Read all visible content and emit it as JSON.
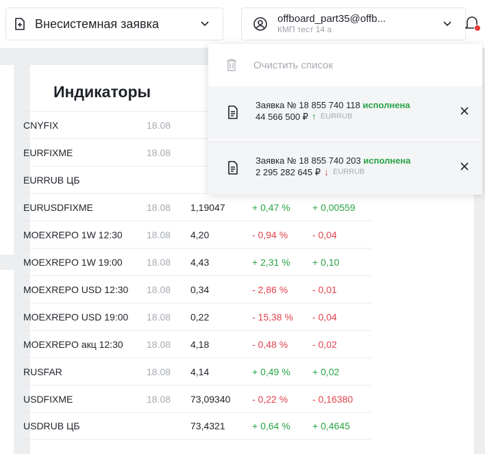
{
  "header": {
    "request_type": "Внесистемная заявка",
    "account_email": "offboard_part35@offb...",
    "account_sub": "КМП тест 14 а"
  },
  "notifications": {
    "clear_label": "Очистить список",
    "items": [
      {
        "title": "Заявка № 18 855 740 118",
        "status": "исполнена",
        "amount": "44 566 500 ₽",
        "direction": "up",
        "arrow": "↑",
        "currency": "EURRUB"
      },
      {
        "title": "Заявка № 18 855 740 203",
        "status": "исполнена",
        "amount": "2 295 282 645 ₽",
        "direction": "down",
        "arrow": "↓",
        "currency": "EURRUB"
      }
    ]
  },
  "indicators": {
    "title": "Индикаторы",
    "rows": [
      {
        "name": "CNYFIX",
        "date": "18.08",
        "value": "",
        "pct": "",
        "change": "",
        "trend": ""
      },
      {
        "name": "EURFIXME",
        "date": "18.08",
        "value": "",
        "pct": "",
        "change": "",
        "trend": ""
      },
      {
        "name": "EURRUB ЦБ",
        "date": "",
        "value": "",
        "pct": "",
        "change": "",
        "trend": ""
      },
      {
        "name": "EURUSDFIXME",
        "date": "18.08",
        "value": "1,19047",
        "pct": "+ 0,47 %",
        "change": "+ 0,00559",
        "trend": "pos"
      },
      {
        "name": "MOEXREPO 1W 12:30",
        "date": "18.08",
        "value": "4,20",
        "pct": "- 0,94 %",
        "change": "- 0,04",
        "trend": "neg"
      },
      {
        "name": "MOEXREPO 1W 19:00",
        "date": "18.08",
        "value": "4,43",
        "pct": "+ 2,31 %",
        "change": "+ 0,10",
        "trend": "pos"
      },
      {
        "name": "MOEXREPO USD 12:30",
        "date": "18.08",
        "value": "0,34",
        "pct": "- 2,86 %",
        "change": "- 0,01",
        "trend": "neg"
      },
      {
        "name": "MOEXREPO USD 19:00",
        "date": "18.08",
        "value": "0,22",
        "pct": "- 15,38 %",
        "change": "- 0,04",
        "trend": "neg"
      },
      {
        "name": "MOEXREPO акц 12:30",
        "date": "18.08",
        "value": "4,18",
        "pct": "- 0,48 %",
        "change": "- 0,02",
        "trend": "neg"
      },
      {
        "name": "RUSFAR",
        "date": "18.08",
        "value": "4,14",
        "pct": "+ 0,49 %",
        "change": "+ 0,02",
        "trend": "pos"
      },
      {
        "name": "USDFIXME",
        "date": "18.08",
        "value": "73,09340",
        "pct": "- 0,22 %",
        "change": "- 0,16380",
        "trend": "neg"
      },
      {
        "name": "USDRUB ЦБ",
        "date": "",
        "value": "73,4321",
        "pct": "+ 0,64 %",
        "change": "+ 0,4645",
        "trend": "pos"
      }
    ]
  },
  "colors": {
    "positive": "#27a243",
    "negative": "#e0424a",
    "badge": "#e53935"
  },
  "icons": {
    "request": "document-plus-icon",
    "account": "user-circle-icon",
    "bell": "bell-icon",
    "clear": "trash-icon",
    "notification": "document-icon",
    "close": "close-icon",
    "dropdown": "chevron-down-icon"
  }
}
